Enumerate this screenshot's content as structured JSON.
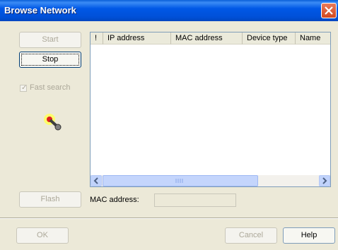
{
  "window": {
    "title": "Browse Network"
  },
  "buttons": {
    "start": "Start",
    "stop": "Stop",
    "flash": "Flash",
    "ok": "OK",
    "cancel": "Cancel",
    "help": "Help"
  },
  "options": {
    "fast_search_label": "Fast search",
    "fast_search_checked": true
  },
  "table": {
    "columns": [
      "!",
      "IP address",
      "MAC address",
      "Device type",
      "Name"
    ],
    "rows": []
  },
  "mac_field": {
    "label": "MAC address:",
    "value": ""
  },
  "icons": {
    "close": "close-icon",
    "busy": "wait-cursor-icon"
  }
}
